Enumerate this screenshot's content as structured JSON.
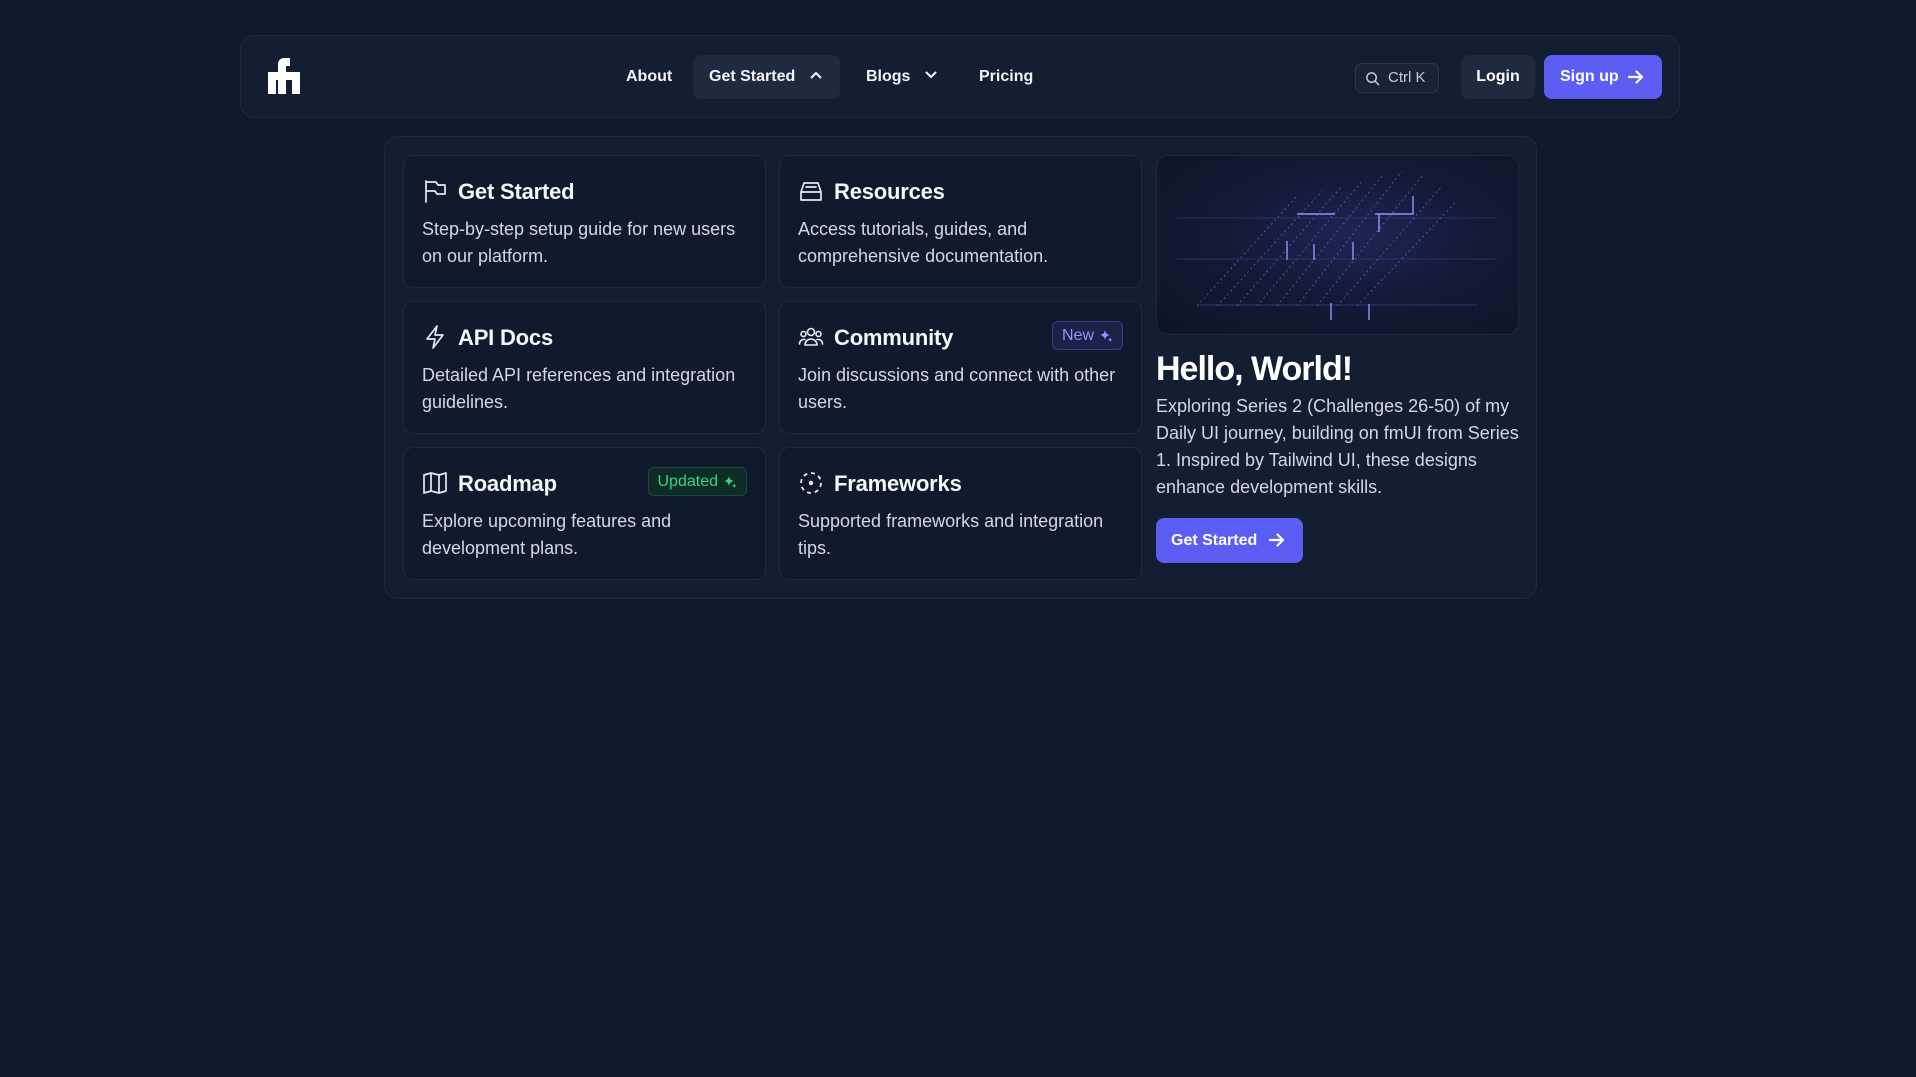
{
  "brand": {
    "logo_icon": "fm-logo-icon"
  },
  "nav": {
    "about": "About",
    "get_started": "Get Started",
    "blogs": "Blogs",
    "pricing": "Pricing"
  },
  "search": {
    "shortcut": "Ctrl K",
    "icon": "search-icon"
  },
  "auth": {
    "login": "Login",
    "signup": "Sign up"
  },
  "menu": {
    "cards": [
      {
        "icon": "flag-icon",
        "title": "Get Started",
        "description": "Step-by-step setup guide for new users on our platform."
      },
      {
        "icon": "inbox-icon",
        "title": "Resources",
        "description": "Access tutorials, guides, and comprehensive documentation."
      },
      {
        "icon": "lightning-icon",
        "title": "API Docs",
        "description": "Detailed API references and integration guidelines."
      },
      {
        "icon": "users-icon",
        "title": "Community",
        "description": "Join discussions and connect with other users.",
        "badge": "New"
      },
      {
        "icon": "map-icon",
        "title": "Roadmap",
        "description": "Explore upcoming features and development plans.",
        "badge": "Updated"
      },
      {
        "icon": "dashed-circle-icon",
        "title": "Frameworks",
        "description": "Supported frameworks and integration tips."
      }
    ]
  },
  "hero": {
    "title": "Hello, World!",
    "text": "Exploring Series 2 (Challenges 26-50) of my Daily UI journey, building on fmUI from Series 1. Inspired by Tailwind UI, these designs enhance development skills.",
    "cta": "Get Started"
  },
  "colors": {
    "background": "#111a2c",
    "panel": "#141e33",
    "accent": "#5b5df3",
    "badge_new": "#8e96ff",
    "badge_updated": "#2fd57f"
  }
}
